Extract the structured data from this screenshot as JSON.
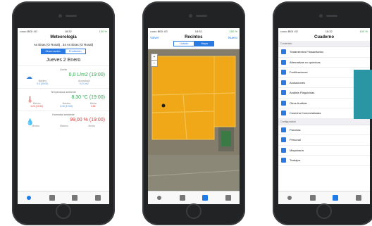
{
  "status": {
    "carrier": "••ooo BIDI 4G",
    "time": "18:32",
    "battery": "100 %"
  },
  "screen1": {
    "title": "Meteorología",
    "location": "As Eiras (O Rosal) , 34 As Eiras (O Rosal)",
    "tabs": [
      "Observación",
      "Predicción"
    ],
    "day": "Jueves 2 Enero",
    "sections": [
      {
        "heading": "Lluvia",
        "value": "0,0 L/m2 (19:00)",
        "icon": "cloud-icon",
        "stats": [
          {
            "label": "Máximo",
            "value": "0,0 (00:00)"
          },
          {
            "label": "Acumulado",
            "value": "0,0 L/m2"
          }
        ]
      },
      {
        "heading": "Temperatura ambiente",
        "value": "8,30 °C (19:00)",
        "icon": "thermometer-icon",
        "stats": [
          {
            "label": "Mínimo",
            "value": "1,20 (12:50)"
          },
          {
            "label": "Máximo",
            "value": "8,30 (19:00)"
          },
          {
            "label": "Media",
            "value": "3,56"
          }
        ]
      },
      {
        "heading": "Humedad ambiente",
        "value": "99,00 % (19:00)",
        "icon": "droplet-icon",
        "stats": [
          {
            "label": "Mínimo",
            "value": ""
          },
          {
            "label": "Máximo",
            "value": ""
          },
          {
            "label": "Media",
            "value": ""
          }
        ]
      }
    ]
  },
  "screen2": {
    "back": "Volver",
    "title": "Recintos",
    "new": "Nuevo",
    "tabs": [
      "Listado",
      "Mapa"
    ],
    "zoom_in": "+",
    "zoom_out": "−"
  },
  "screen3": {
    "title": "Cuaderno",
    "section1": "Contenido",
    "items1": [
      {
        "label": "Tratamientos Fitosanitarios",
        "color": "#2a7ae2"
      },
      {
        "label": "Alternativas no químicas",
        "color": "#2a7ae2"
      },
      {
        "label": "Fertilizaciones",
        "color": "#2a7ae2"
      },
      {
        "label": "Anotaciones",
        "color": "#2a7ae2"
      },
      {
        "label": "Análisis Plaguicidas",
        "color": "#2a7ae2"
      },
      {
        "label": "Otros Análisis",
        "color": "#2a7ae2"
      },
      {
        "label": "Cosecha Comercializada",
        "color": "#2a7ae2"
      }
    ],
    "section2": "Configuración",
    "items2": [
      {
        "label": "Parcelas",
        "color": "#2a7ae2"
      },
      {
        "label": "Personal",
        "color": "#2a7ae2"
      },
      {
        "label": "Maquinaria",
        "color": "#2a7ae2"
      },
      {
        "label": "Trabajos",
        "color": "#2a7ae2"
      }
    ]
  }
}
